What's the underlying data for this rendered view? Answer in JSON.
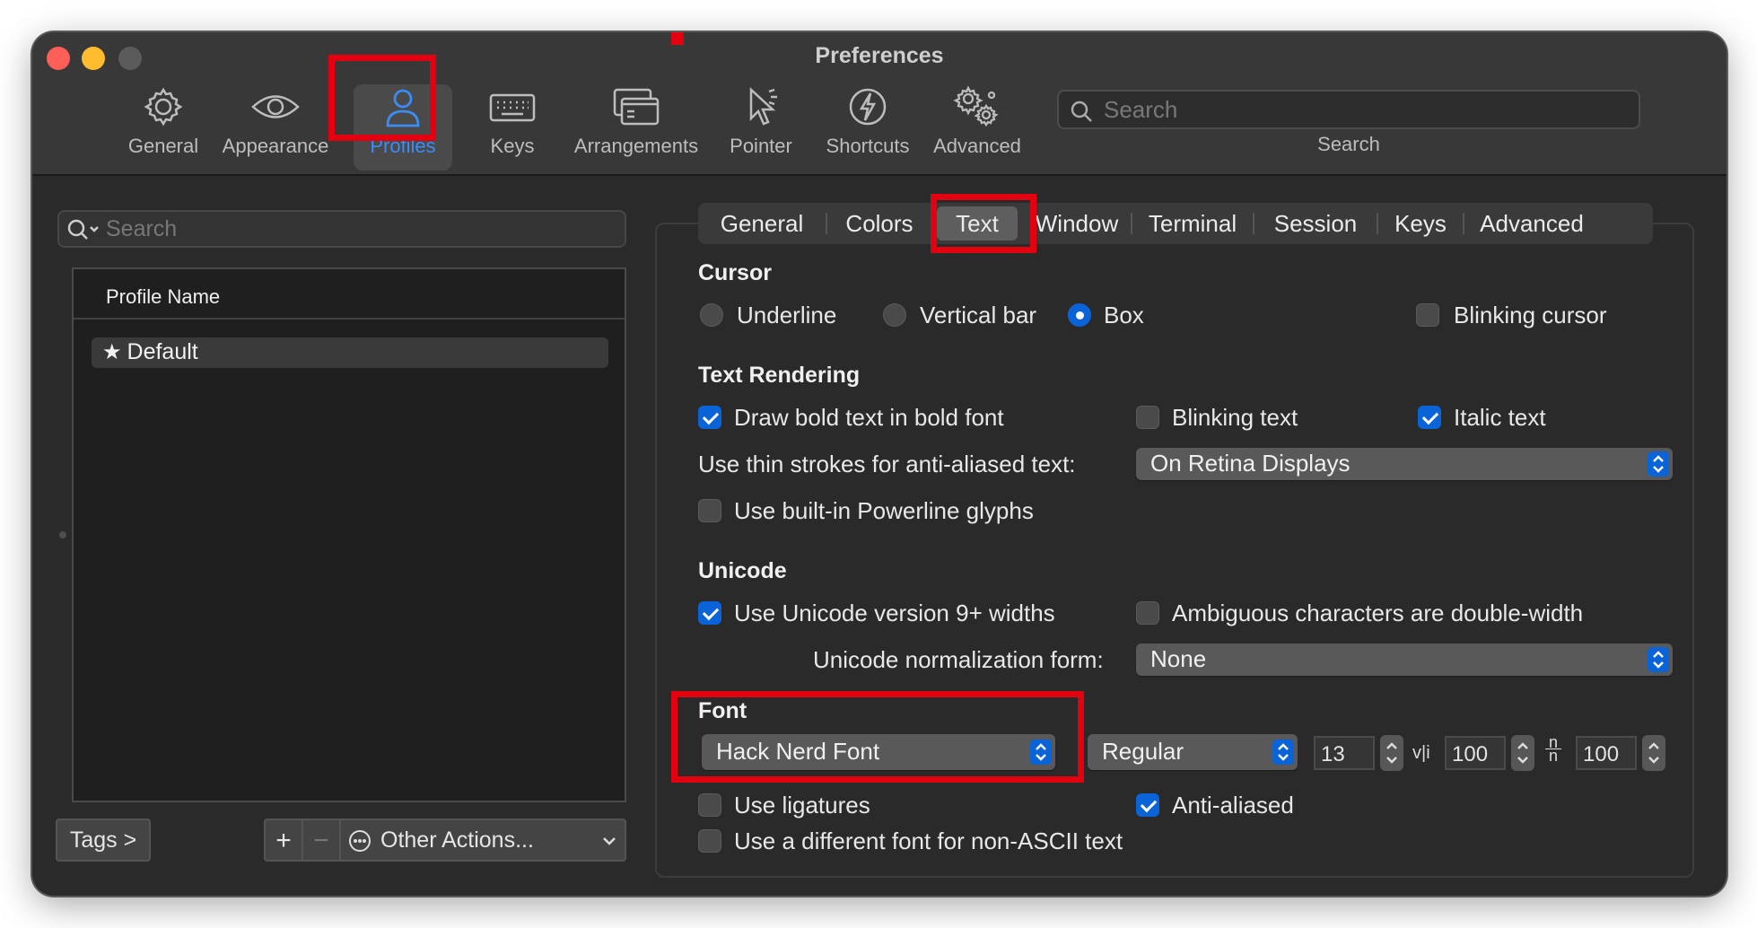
{
  "window": {
    "title": "Preferences"
  },
  "toolbar": {
    "items": [
      {
        "label": "General",
        "icon": "gear-icon"
      },
      {
        "label": "Appearance",
        "icon": "eye-icon"
      },
      {
        "label": "Profiles",
        "icon": "person-icon"
      },
      {
        "label": "Keys",
        "icon": "keyboard-icon"
      },
      {
        "label": "Arrangements",
        "icon": "windows-icon"
      },
      {
        "label": "Pointer",
        "icon": "pointer-icon"
      },
      {
        "label": "Shortcuts",
        "icon": "lightning-icon"
      },
      {
        "label": "Advanced",
        "icon": "gears-icon"
      }
    ],
    "selected": "Profiles",
    "search_placeholder": "Search",
    "search_label": "Search"
  },
  "sidebar": {
    "search_placeholder": "Search",
    "column_header": "Profile Name",
    "profiles": [
      {
        "name": "Default",
        "starred": true
      }
    ],
    "tags_button": "Tags >",
    "add_button": "+",
    "remove_button": "−",
    "other_actions": "Other Actions..."
  },
  "tabs": [
    "General",
    "Colors",
    "Text",
    "Window",
    "Terminal",
    "Session",
    "Keys",
    "Advanced"
  ],
  "selected_tab": "Text",
  "cursor": {
    "heading": "Cursor",
    "options": [
      "Underline",
      "Vertical bar",
      "Box"
    ],
    "selected": "Box",
    "blinking_label": "Blinking cursor",
    "blinking": false
  },
  "text_rendering": {
    "heading": "Text Rendering",
    "bold_label": "Draw bold text in bold font",
    "bold": true,
    "blinking_label": "Blinking text",
    "blinking": false,
    "italic_label": "Italic text",
    "italic": true,
    "thin_strokes_label": "Use thin strokes for anti-aliased text:",
    "thin_strokes_value": "On Retina Displays",
    "powerline_label": "Use built-in Powerline glyphs",
    "powerline": false
  },
  "unicode": {
    "heading": "Unicode",
    "v9_label": "Use Unicode version 9+ widths",
    "v9": true,
    "ambiguous_label": "Ambiguous characters are double-width",
    "ambiguous": false,
    "normalization_label": "Unicode normalization form:",
    "normalization_value": "None"
  },
  "font": {
    "heading": "Font",
    "family": "Hack Nerd Font",
    "style": "Regular",
    "size": "13",
    "hspacing_icon": "v|i",
    "hspacing": "100",
    "vspacing_icon": "n/n",
    "vspacing": "100",
    "ligatures_label": "Use ligatures",
    "ligatures": false,
    "antialiased_label": "Anti-aliased",
    "antialiased": true,
    "nonascii_label": "Use a different font for non-ASCII text",
    "nonascii": false
  },
  "colors": {
    "accent": "#0a64d8",
    "highlight_box": "#e3000f",
    "active_toolbar": "#3b8cf5"
  }
}
